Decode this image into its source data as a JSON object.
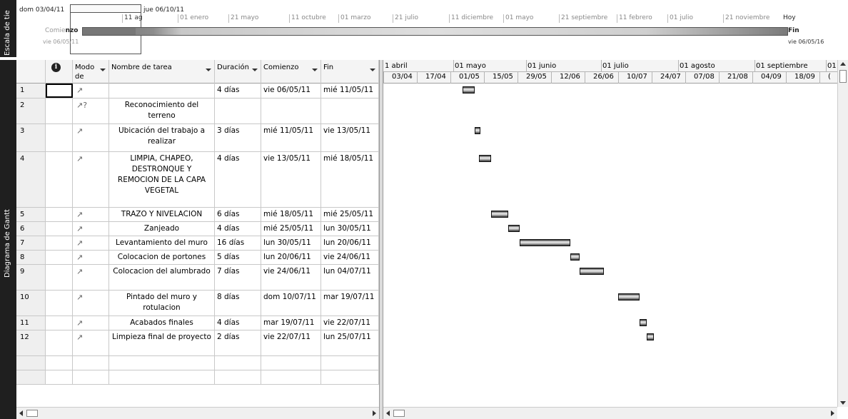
{
  "timeline": {
    "side_label": "Escala de tie",
    "start_date": "dom 03/04/11",
    "end_date": "jue 06/10/11",
    "today_label": "Hoy",
    "ticks": [
      {
        "label": "11 ag",
        "dark": true
      },
      {
        "label": "01 enero",
        "dark": false
      },
      {
        "label": "21 mayo",
        "dark": false
      },
      {
        "label": "11 octubre",
        "dark": false
      },
      {
        "label": "01 marzo",
        "dark": false
      },
      {
        "label": "21 julio",
        "dark": false
      },
      {
        "label": "11 diciembre",
        "dark": false
      },
      {
        "label": "01 mayo",
        "dark": false
      },
      {
        "label": "21 septiembre",
        "dark": false
      },
      {
        "label": "11 febrero",
        "dark": false
      },
      {
        "label": "01 julio",
        "dark": false
      },
      {
        "label": "21 noviembre",
        "dark": false
      }
    ],
    "start_label_pre": "Comie",
    "start_label_bold": "nzo",
    "start_value": "vie 06/05/11",
    "end_label": "Fin",
    "end_value": "vie 06/05/16"
  },
  "gantt_side_label": "Diagrama de Gantt",
  "columns": {
    "info_icon": "i",
    "mode": "Modo de",
    "name": "Nombre de tarea",
    "duration": "Duración",
    "start": "Comienzo",
    "finish": "Fin"
  },
  "tasks": [
    {
      "id": "1",
      "mode_icon": "pin-icon",
      "name": "",
      "duration": "4 días",
      "start": "vie 06/05/11",
      "finish": "mié 11/05/11"
    },
    {
      "id": "2",
      "mode_icon": "pin-question-icon",
      "name": "Reconocimiento del terreno",
      "duration": "",
      "start": "",
      "finish": ""
    },
    {
      "id": "3",
      "mode_icon": "pin-icon",
      "name": "Ubicación del trabajo a realizar",
      "duration": "3 días",
      "start": "mié 11/05/11",
      "finish": "vie 13/05/11"
    },
    {
      "id": "4",
      "mode_icon": "pin-icon",
      "name": "LIMPIA, CHAPEO, DESTRONQUE Y REMOCION DE LA CAPA VEGETAL",
      "duration": "4 días",
      "start": "vie 13/05/11",
      "finish": "mié 18/05/11"
    },
    {
      "id": "5",
      "mode_icon": "pin-icon",
      "name": "TRAZO Y NIVELACION",
      "duration": "6 días",
      "start": "mié 18/05/11",
      "finish": "mié 25/05/11"
    },
    {
      "id": "6",
      "mode_icon": "pin-icon",
      "name": "Zanjeado",
      "duration": "4 días",
      "start": "mié 25/05/11",
      "finish": "lun 30/05/11"
    },
    {
      "id": "7",
      "mode_icon": "pin-icon",
      "name": "Levantamiento del muro",
      "duration": "16 días",
      "start": "lun 30/05/11",
      "finish": "lun 20/06/11"
    },
    {
      "id": "8",
      "mode_icon": "pin-icon",
      "name": "Colocacion de portones",
      "duration": "5 días",
      "start": "lun 20/06/11",
      "finish": "vie 24/06/11"
    },
    {
      "id": "9",
      "mode_icon": "pin-icon",
      "name": "Colocacion del alumbrado",
      "duration": "7 días",
      "start": "vie 24/06/11",
      "finish": "lun 04/07/11"
    },
    {
      "id": "10",
      "mode_icon": "pin-icon",
      "name": "Pintado del muro y rotulacion",
      "duration": "8 días",
      "start": "dom 10/07/11",
      "finish": "mar 19/07/11"
    },
    {
      "id": "11",
      "mode_icon": "pin-icon",
      "name": "Acabados finales",
      "duration": "4 días",
      "start": "mar 19/07/11",
      "finish": "vie 22/07/11"
    },
    {
      "id": "12",
      "mode_icon": "pin-icon",
      "name": "Limpieza final de proyecto",
      "duration": "2 días",
      "start": "vie 22/07/11",
      "finish": "lun 25/07/11"
    }
  ],
  "chart": {
    "months": [
      "1 abril",
      "01 mayo",
      "01 junio",
      "01 julio",
      "01 agosto",
      "01 septiembre",
      "01"
    ],
    "weeks": [
      "03/04",
      "17/04",
      "01/05",
      "15/05",
      "29/05",
      "12/06",
      "26/06",
      "10/07",
      "24/07",
      "07/08",
      "21/08",
      "04/09",
      "18/09",
      "("
    ]
  }
}
